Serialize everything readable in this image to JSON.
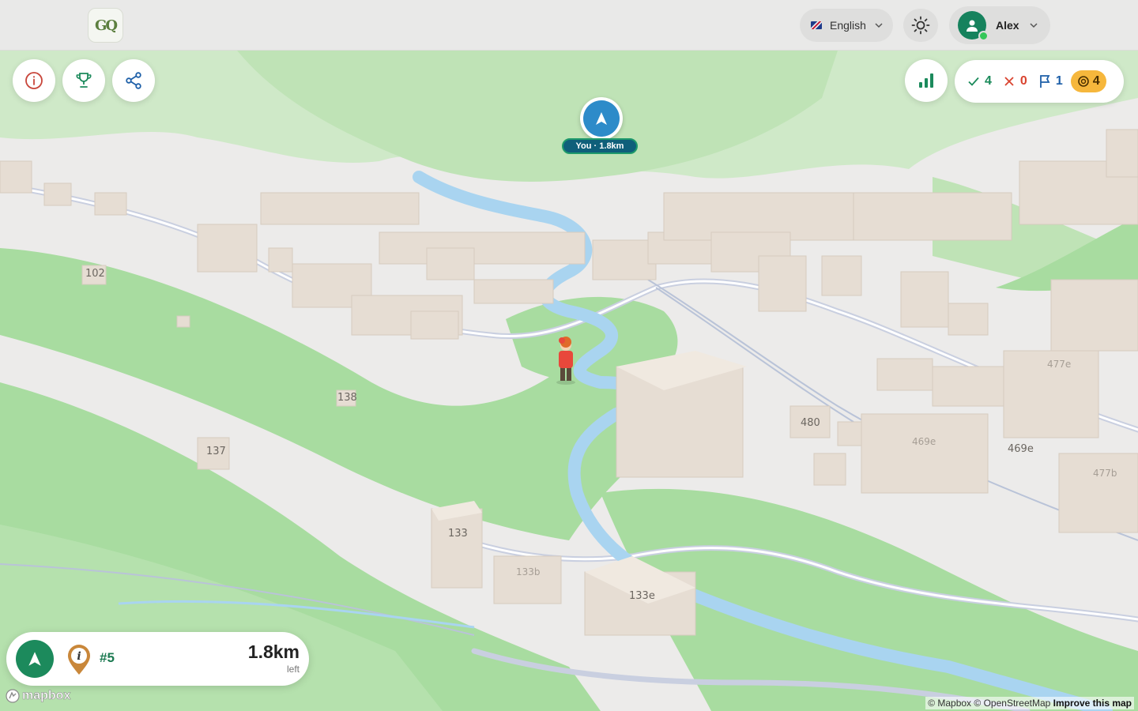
{
  "header": {
    "logo_text": "GQ",
    "language_label": "English",
    "user_name": "Alex"
  },
  "toolbar_left": {
    "info_icon": "info-icon",
    "trophy_icon": "trophy-icon",
    "share_icon": "share-icon"
  },
  "stats": {
    "correct": "4",
    "wrong": "0",
    "flags": "1",
    "coins": "4"
  },
  "player_marker": {
    "label": "You · 1.8km"
  },
  "map_labels": {
    "l102": "102",
    "l138": "138",
    "l137": "137",
    "l133": "133",
    "l133b": "133b",
    "l133e": "133e",
    "l480": "480",
    "l469e_faint": "469e",
    "l469e": "469e",
    "l477e": "477e",
    "l477b": "477b"
  },
  "target_card": {
    "target_number": "#5",
    "distance": "1.8km",
    "distance_suffix": "left"
  },
  "footer": {
    "mapbox_logo": "mapbox",
    "attr_mapbox": "© Mapbox",
    "attr_osm": "© OpenStreetMap",
    "attr_improve": "Improve this map"
  },
  "colors": {
    "accent_green": "#1c8a5c",
    "marker_blue": "#2d8bc9",
    "coin_yellow": "#f6b73c",
    "park_green": "#a8dca0",
    "river_blue": "#a9d4f0",
    "building": "#e6ddd3"
  }
}
